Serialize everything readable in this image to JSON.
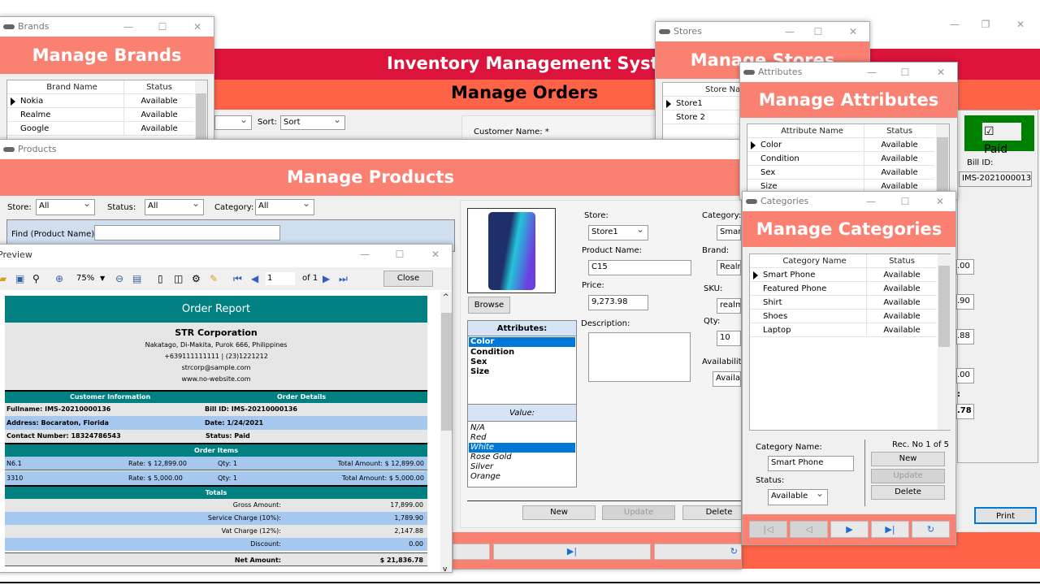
{
  "main": {
    "title": "Inventory Management System",
    "subtitle": "Manage Orders",
    "sort_label": "Sort:",
    "sort_value": "Sort",
    "customer_name_label": "Customer Name: *",
    "paid_label": "Paid",
    "bill_id_label": "Bill ID:",
    "bill_id": "IMS-20210000136",
    "amounts": [
      ".00",
      ".90",
      ".88",
      ".00",
      ".78"
    ],
    "net_label": ":",
    "print": "Print"
  },
  "brands": {
    "window_title": "Brands",
    "header": "Manage Brands",
    "columns": [
      "Brand Name",
      "Status"
    ],
    "rows": [
      [
        "Nokia",
        "Available"
      ],
      [
        "Realme",
        "Available"
      ],
      [
        "Google",
        "Available"
      ]
    ]
  },
  "stores": {
    "window_title": "Stores",
    "header": "Manage Stores",
    "columns": [
      "Store Name"
    ],
    "rows": [
      "Store1",
      "Store 2"
    ]
  },
  "attributes": {
    "window_title": "Attributes",
    "header": "Manage Attributes",
    "columns": [
      "Attribute Name",
      "Status"
    ],
    "rows": [
      [
        "Color",
        "Available"
      ],
      [
        "Condition",
        "Available"
      ],
      [
        "Sex",
        "Available"
      ],
      [
        "Size",
        "Available"
      ]
    ]
  },
  "categories": {
    "window_title": "Categories",
    "header": "Manage Categories",
    "columns": [
      "Category Name",
      "Status"
    ],
    "rows": [
      [
        "Smart Phone",
        "Available"
      ],
      [
        "Featured Phone",
        "Available"
      ],
      [
        "Shirt",
        "Available"
      ],
      [
        "Shoes",
        "Available"
      ],
      [
        "Laptop",
        "Available"
      ]
    ],
    "name_label": "Category Name:",
    "name_value": "Smart Phone",
    "status_label": "Status:",
    "status_value": "Available",
    "rec": "Rec. No 1 of 5",
    "new": "New",
    "update": "Update",
    "delete": "Delete"
  },
  "products": {
    "window_title": "Products",
    "header": "Manage Products",
    "store_label": "Store:",
    "store_value": "All",
    "status_label": "Status:",
    "status_value": "All",
    "category_label": "Category:",
    "category_value": "All",
    "find_label": "Find (Product Name):",
    "find_value": "",
    "browse": "Browse",
    "attributes_label": "Attributes:",
    "attributes": [
      "Color",
      "Condition",
      "Sex",
      "Size"
    ],
    "value_label": "Value:",
    "values": [
      "N/A",
      "Red",
      "White",
      "Rose Gold",
      "Silver",
      "Orange"
    ],
    "form": {
      "store_label": "Store:",
      "store_value": "Store1",
      "name_label": "Product Name:",
      "name_value": "C15",
      "price_label": "Price:",
      "price_value": "9,273.98",
      "desc_label": "Description:",
      "category_label": "Category:",
      "category_value": "Smart",
      "brand_label": "Brand:",
      "brand_value": "Realm",
      "sku_label": "SKU:",
      "sku_value": "realm",
      "qty_label": "Qty:",
      "qty_value": "10",
      "avail_label": "Availability",
      "avail_value": "Availat"
    },
    "new": "New",
    "update": "Update",
    "delete": "Delete"
  },
  "preview": {
    "window_title": "Preview",
    "zoom": "75%",
    "page": "1",
    "of": "of 1",
    "close": "Close",
    "report": {
      "title": "Order Report",
      "company": "STR Corporation",
      "address": "Nakatago, Di-Makita, Purok 666, Philippines",
      "phone": "+639111111111 | (23)1221212",
      "email": "strcorp@sample.com",
      "website": "www.no-website.com",
      "customer_header": "Customer Information",
      "order_header": "Order Details",
      "fullname": "Fullname: IMS-20210000136",
      "bill": "Bill ID: IMS-20210000136",
      "address_line": "Address: Bocaraton, Florida",
      "date": "Date: 1/24/2021",
      "contact": "Contact Number: 18324786543",
      "status": "Status: Paid",
      "items_header": "Order Items",
      "items": [
        {
          "name": "N6.1",
          "rate": "Rate: $ 12,899.00",
          "qty": "Qty: 1",
          "total": "Total Amount: $ 12,899.00"
        },
        {
          "name": "3310",
          "rate": "Rate: $ 5,000.00",
          "qty": "Qty: 1",
          "total": "Total Amount: $ 5,000.00"
        }
      ],
      "totals_header": "Totals",
      "totals": [
        {
          "label": "Gross Amount:",
          "value": "17,899.00"
        },
        {
          "label": "Service Charge (10%):",
          "value": "1,789.90"
        },
        {
          "label": "Vat Charge (12%):",
          "value": "2,147.88"
        },
        {
          "label": "Discount:",
          "value": "0.00"
        }
      ],
      "net_label": "Net Amount:",
      "net_value": "$ 21,836.78"
    }
  },
  "colors": {
    "banner": "#dc143c",
    "orders_band": "#ff6347",
    "header": "#fa8072",
    "report_teal": "#008080",
    "paid_green": "#008000",
    "selection": "#0078d7"
  }
}
